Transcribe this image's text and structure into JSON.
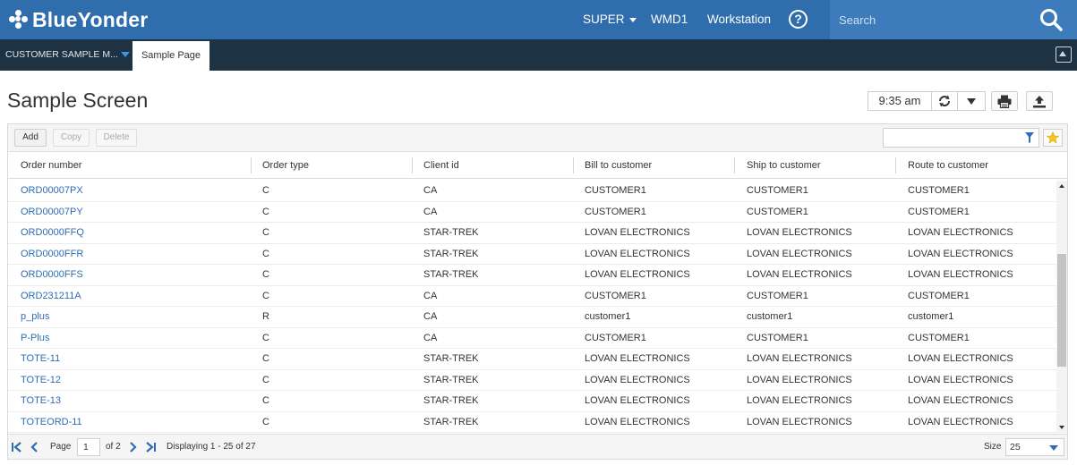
{
  "header": {
    "brand": "BlueYonder",
    "nav": [
      {
        "label": "SUPER",
        "dropdown": true
      },
      {
        "label": "WMD1"
      },
      {
        "label": "Workstation"
      }
    ],
    "help_icon": "question-circle-icon",
    "search": {
      "placeholder": "Search",
      "icon": "search-icon"
    }
  },
  "tabs": {
    "menu_label": "CUSTOMER SAMPLE M...",
    "active_tab": "Sample Page"
  },
  "page": {
    "title": "Sample Screen",
    "time": "9:35 am"
  },
  "toolbar": {
    "add": "Add",
    "copy": "Copy",
    "delete": "Delete",
    "filter_value": ""
  },
  "grid": {
    "columns": [
      "Order number",
      "Order type",
      "Client id",
      "Bill to customer",
      "Ship to customer",
      "Route to customer"
    ],
    "rows": [
      [
        "ORD00007PX",
        "C",
        "CA",
        "CUSTOMER1",
        "CUSTOMER1",
        "CUSTOMER1"
      ],
      [
        "ORD00007PY",
        "C",
        "CA",
        "CUSTOMER1",
        "CUSTOMER1",
        "CUSTOMER1"
      ],
      [
        "ORD0000FFQ",
        "C",
        "STAR-TREK",
        "LOVAN ELECTRONICS",
        "LOVAN ELECTRONICS",
        "LOVAN ELECTRONICS"
      ],
      [
        "ORD0000FFR",
        "C",
        "STAR-TREK",
        "LOVAN ELECTRONICS",
        "LOVAN ELECTRONICS",
        "LOVAN ELECTRONICS"
      ],
      [
        "ORD0000FFS",
        "C",
        "STAR-TREK",
        "LOVAN ELECTRONICS",
        "LOVAN ELECTRONICS",
        "LOVAN ELECTRONICS"
      ],
      [
        "ORD231211A",
        "C",
        "CA",
        "CUSTOMER1",
        "CUSTOMER1",
        "CUSTOMER1"
      ],
      [
        "p_plus",
        "R",
        "CA",
        "customer1",
        "customer1",
        "customer1"
      ],
      [
        "P-Plus",
        "C",
        "CA",
        "CUSTOMER1",
        "CUSTOMER1",
        "CUSTOMER1"
      ],
      [
        "TOTE-11",
        "C",
        "STAR-TREK",
        "LOVAN ELECTRONICS",
        "LOVAN ELECTRONICS",
        "LOVAN ELECTRONICS"
      ],
      [
        "TOTE-12",
        "C",
        "STAR-TREK",
        "LOVAN ELECTRONICS",
        "LOVAN ELECTRONICS",
        "LOVAN ELECTRONICS"
      ],
      [
        "TOTE-13",
        "C",
        "STAR-TREK",
        "LOVAN ELECTRONICS",
        "LOVAN ELECTRONICS",
        "LOVAN ELECTRONICS"
      ],
      [
        "TOTEORD-11",
        "C",
        "STAR-TREK",
        "LOVAN ELECTRONICS",
        "LOVAN ELECTRONICS",
        "LOVAN ELECTRONICS"
      ]
    ]
  },
  "pager": {
    "page_label": "Page",
    "page_value": "1",
    "of_label": "of 2",
    "displaying": "Displaying 1 - 25 of 27",
    "size_label": "Size",
    "size_value": "25"
  },
  "colors": {
    "header_bg": "#2f6dac",
    "search_bg": "#3d7bbb",
    "tabbar_bg": "#1d3344",
    "link": "#2e6db4"
  }
}
